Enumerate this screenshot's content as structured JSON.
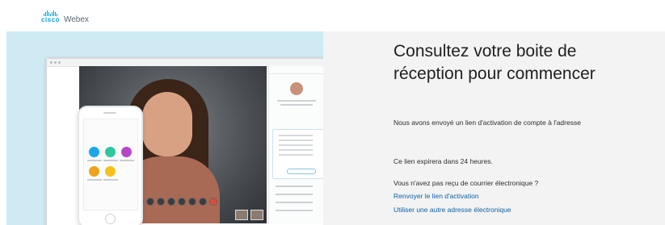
{
  "brand": {
    "company": "cisco",
    "product": "Webex",
    "accent_color": "#049fd9"
  },
  "main": {
    "heading": "Consultez votre boite de réception pour commencer",
    "activation_message": "Nous avons envoyé un lien d'activation de compte à l'adresse",
    "expiry_message": "Ce lien expirera dans 24 heures.",
    "not_received_question": "Vous n'avez pas reçu de courrier électronique ?",
    "resend_link": "Renvoyer le lien d'activation",
    "other_address_link": "Utiliser une autre adresse électronique",
    "link_color": "#0a62a8"
  }
}
